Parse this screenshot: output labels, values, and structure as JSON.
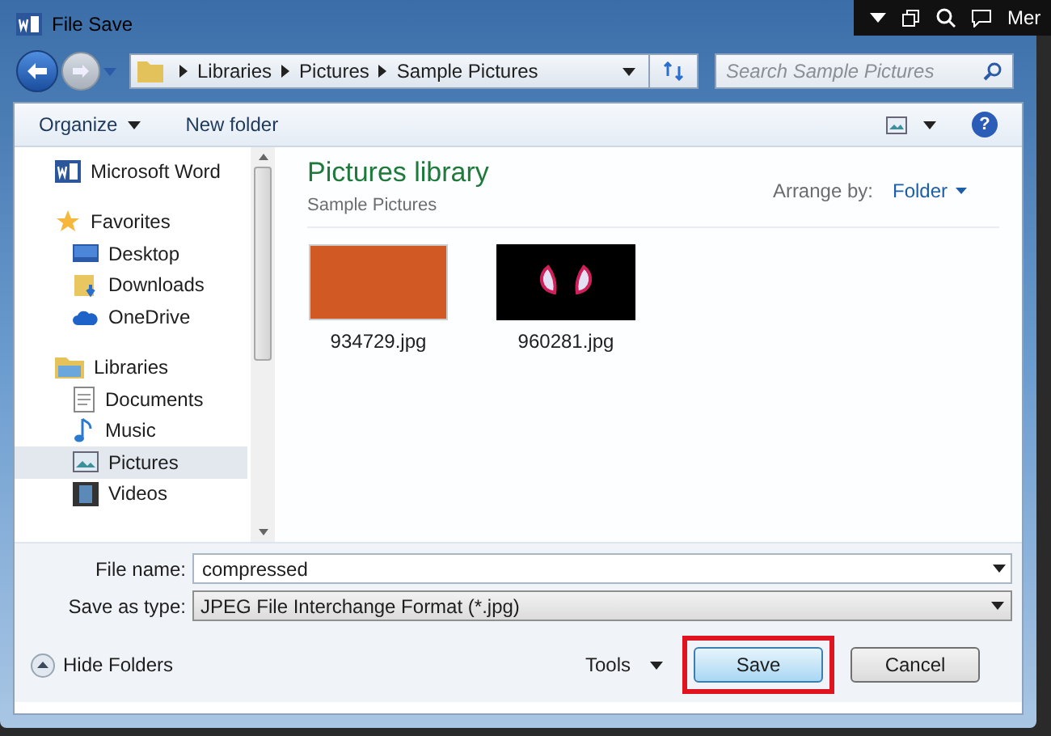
{
  "window": {
    "title": "File Save"
  },
  "taskbar": {
    "text": "Mer"
  },
  "address": {
    "segments": [
      "Libraries",
      "Pictures",
      "Sample Pictures"
    ]
  },
  "search": {
    "placeholder": "Search Sample Pictures"
  },
  "toolbar": {
    "organize": "Organize",
    "new_folder": "New folder",
    "help": "?"
  },
  "sidebar": {
    "items": [
      {
        "label": "Microsoft Word",
        "kind": "word",
        "selected": false
      },
      {
        "label": "Favorites",
        "kind": "star",
        "selected": false,
        "children": [
          {
            "label": "Desktop",
            "kind": "desktop",
            "selected": false
          },
          {
            "label": "Downloads",
            "kind": "downloads",
            "selected": false
          },
          {
            "label": "OneDrive",
            "kind": "cloud",
            "selected": false
          }
        ]
      },
      {
        "label": "Libraries",
        "kind": "libraries",
        "selected": false,
        "children": [
          {
            "label": "Documents",
            "kind": "documents",
            "selected": false
          },
          {
            "label": "Music",
            "kind": "music",
            "selected": false
          },
          {
            "label": "Pictures",
            "kind": "pictures",
            "selected": true
          },
          {
            "label": "Videos",
            "kind": "videos",
            "selected": false
          }
        ]
      }
    ]
  },
  "library": {
    "title": "Pictures library",
    "subtitle": "Sample Pictures",
    "arrange_label": "Arrange by:",
    "arrange_value": "Folder"
  },
  "files": [
    {
      "name": "934729.jpg",
      "kind": "scene"
    },
    {
      "name": "960281.jpg",
      "kind": "mask"
    }
  ],
  "form": {
    "file_name_label": "File name:",
    "file_name": "compressed",
    "type_label": "Save as type:",
    "type_value": "JPEG File Interchange Format (*.jpg)"
  },
  "footer": {
    "hide_folders": "Hide Folders",
    "tools": "Tools",
    "buttons": [
      {
        "label": "Save",
        "highlighted": true
      },
      {
        "label": "Cancel",
        "highlighted": false
      }
    ]
  }
}
